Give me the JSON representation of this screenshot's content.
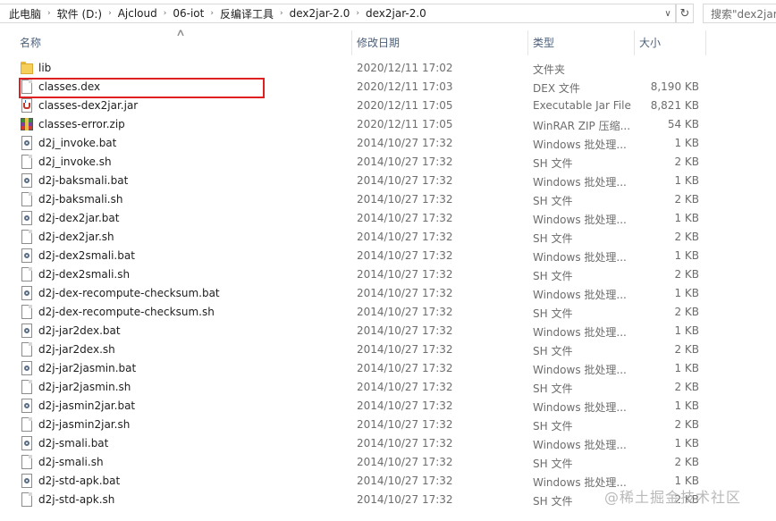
{
  "breadcrumb": [
    "此电脑",
    "软件 (D:)",
    "Ajcloud",
    "06-iot",
    "反编译工具",
    "dex2jar-2.0",
    "dex2jar-2.0"
  ],
  "search": {
    "placeholder": "搜索\"dex2jar"
  },
  "columns": {
    "name": "名称",
    "date": "修改日期",
    "type": "类型",
    "size": "大小"
  },
  "files": [
    {
      "name": "lib",
      "date": "2020/12/11 17:02",
      "type": "文件夹",
      "size": "",
      "icon": "folder-icon"
    },
    {
      "name": "classes.dex",
      "date": "2020/12/11 17:03",
      "type": "DEX 文件",
      "size": "8,190 KB",
      "icon": "file-icon"
    },
    {
      "name": "classes-dex2jar.jar",
      "date": "2020/12/11 17:05",
      "type": "Executable Jar File",
      "size": "8,821 KB",
      "icon": "jar-icon"
    },
    {
      "name": "classes-error.zip",
      "date": "2020/12/11 17:05",
      "type": "WinRAR ZIP 压缩...",
      "size": "54 KB",
      "icon": "zip-icon"
    },
    {
      "name": "d2j_invoke.bat",
      "date": "2014/10/27 17:32",
      "type": "Windows 批处理...",
      "size": "1 KB",
      "icon": "bat-icon"
    },
    {
      "name": "d2j_invoke.sh",
      "date": "2014/10/27 17:32",
      "type": "SH 文件",
      "size": "2 KB",
      "icon": "file-icon"
    },
    {
      "name": "d2j-baksmali.bat",
      "date": "2014/10/27 17:32",
      "type": "Windows 批处理...",
      "size": "1 KB",
      "icon": "bat-icon"
    },
    {
      "name": "d2j-baksmali.sh",
      "date": "2014/10/27 17:32",
      "type": "SH 文件",
      "size": "2 KB",
      "icon": "file-icon"
    },
    {
      "name": "d2j-dex2jar.bat",
      "date": "2014/10/27 17:32",
      "type": "Windows 批处理...",
      "size": "1 KB",
      "icon": "bat-icon"
    },
    {
      "name": "d2j-dex2jar.sh",
      "date": "2014/10/27 17:32",
      "type": "SH 文件",
      "size": "2 KB",
      "icon": "file-icon"
    },
    {
      "name": "d2j-dex2smali.bat",
      "date": "2014/10/27 17:32",
      "type": "Windows 批处理...",
      "size": "1 KB",
      "icon": "bat-icon"
    },
    {
      "name": "d2j-dex2smali.sh",
      "date": "2014/10/27 17:32",
      "type": "SH 文件",
      "size": "2 KB",
      "icon": "file-icon"
    },
    {
      "name": "d2j-dex-recompute-checksum.bat",
      "date": "2014/10/27 17:32",
      "type": "Windows 批处理...",
      "size": "1 KB",
      "icon": "bat-icon"
    },
    {
      "name": "d2j-dex-recompute-checksum.sh",
      "date": "2014/10/27 17:32",
      "type": "SH 文件",
      "size": "2 KB",
      "icon": "file-icon"
    },
    {
      "name": "d2j-jar2dex.bat",
      "date": "2014/10/27 17:32",
      "type": "Windows 批处理...",
      "size": "1 KB",
      "icon": "bat-icon"
    },
    {
      "name": "d2j-jar2dex.sh",
      "date": "2014/10/27 17:32",
      "type": "SH 文件",
      "size": "2 KB",
      "icon": "file-icon"
    },
    {
      "name": "d2j-jar2jasmin.bat",
      "date": "2014/10/27 17:32",
      "type": "Windows 批处理...",
      "size": "1 KB",
      "icon": "bat-icon"
    },
    {
      "name": "d2j-jar2jasmin.sh",
      "date": "2014/10/27 17:32",
      "type": "SH 文件",
      "size": "2 KB",
      "icon": "file-icon"
    },
    {
      "name": "d2j-jasmin2jar.bat",
      "date": "2014/10/27 17:32",
      "type": "Windows 批处理...",
      "size": "1 KB",
      "icon": "bat-icon"
    },
    {
      "name": "d2j-jasmin2jar.sh",
      "date": "2014/10/27 17:32",
      "type": "SH 文件",
      "size": "2 KB",
      "icon": "file-icon"
    },
    {
      "name": "d2j-smali.bat",
      "date": "2014/10/27 17:32",
      "type": "Windows 批处理...",
      "size": "1 KB",
      "icon": "bat-icon"
    },
    {
      "name": "d2j-smali.sh",
      "date": "2014/10/27 17:32",
      "type": "SH 文件",
      "size": "2 KB",
      "icon": "file-icon"
    },
    {
      "name": "d2j-std-apk.bat",
      "date": "2014/10/27 17:32",
      "type": "Windows 批处理...",
      "size": "1 KB",
      "icon": "bat-icon"
    },
    {
      "name": "d2j-std-apk.sh",
      "date": "2014/10/27 17:32",
      "type": "SH 文件",
      "size": "2 KB",
      "icon": "file-icon"
    }
  ],
  "watermark": "@稀土掘金技术社区",
  "highlight_color": "#e02020"
}
